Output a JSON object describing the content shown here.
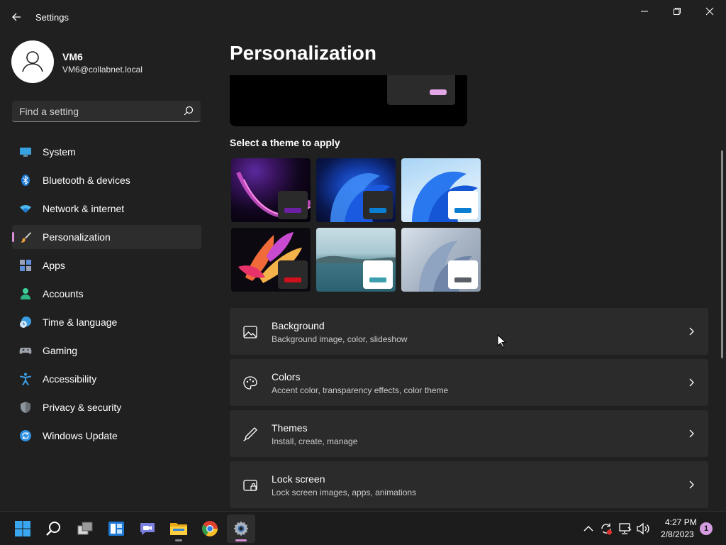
{
  "window": {
    "title": "Settings",
    "controls": [
      "minimize",
      "restore",
      "close"
    ]
  },
  "profile": {
    "name": "VM6",
    "email": "VM6@collabnet.local"
  },
  "search": {
    "placeholder": "Find a setting",
    "value": ""
  },
  "sidebar": {
    "items": [
      {
        "label": "System",
        "icon": "monitor-icon"
      },
      {
        "label": "Bluetooth & devices",
        "icon": "bluetooth-icon"
      },
      {
        "label": "Network & internet",
        "icon": "wifi-icon"
      },
      {
        "label": "Personalization",
        "icon": "brush-icon",
        "active": true
      },
      {
        "label": "Apps",
        "icon": "apps-icon"
      },
      {
        "label": "Accounts",
        "icon": "person-icon"
      },
      {
        "label": "Time & language",
        "icon": "clock-globe-icon"
      },
      {
        "label": "Gaming",
        "icon": "gamepad-icon"
      },
      {
        "label": "Accessibility",
        "icon": "accessibility-icon"
      },
      {
        "label": "Privacy & security",
        "icon": "shield-icon"
      },
      {
        "label": "Windows Update",
        "icon": "update-icon"
      }
    ]
  },
  "main": {
    "title": "Personalization",
    "themes_heading": "Select a theme to apply",
    "themes": [
      {
        "id": "glow",
        "accent": "#6b1fa3"
      },
      {
        "id": "dark-bloom",
        "accent": "#0a7fd1"
      },
      {
        "id": "light-bloom",
        "accent": "#0a7fd1"
      },
      {
        "id": "captured-motion",
        "accent": "#d0101c"
      },
      {
        "id": "sunrise",
        "accent": "#3d9fae"
      },
      {
        "id": "flow",
        "accent": "#5a5e66"
      }
    ],
    "preview_accent": "#e3a6e6",
    "cards": [
      {
        "title": "Background",
        "subtitle": "Background image, color, slideshow",
        "icon": "image-icon"
      },
      {
        "title": "Colors",
        "subtitle": "Accent color, transparency effects, color theme",
        "icon": "palette-icon"
      },
      {
        "title": "Themes",
        "subtitle": "Install, create, manage",
        "icon": "pen-icon"
      },
      {
        "title": "Lock screen",
        "subtitle": "Lock screen images, apps, animations",
        "icon": "lock-screen-icon"
      }
    ]
  },
  "taskbar": {
    "apps": [
      "start",
      "search",
      "task-view",
      "widgets",
      "teams-chat",
      "file-explorer",
      "chrome",
      "settings"
    ],
    "time": "4:27 PM",
    "date": "2/8/2023",
    "notifications": "1"
  },
  "colors": {
    "background": "#202020",
    "card": "#2b2b2b",
    "accent": "#d78fd6"
  }
}
